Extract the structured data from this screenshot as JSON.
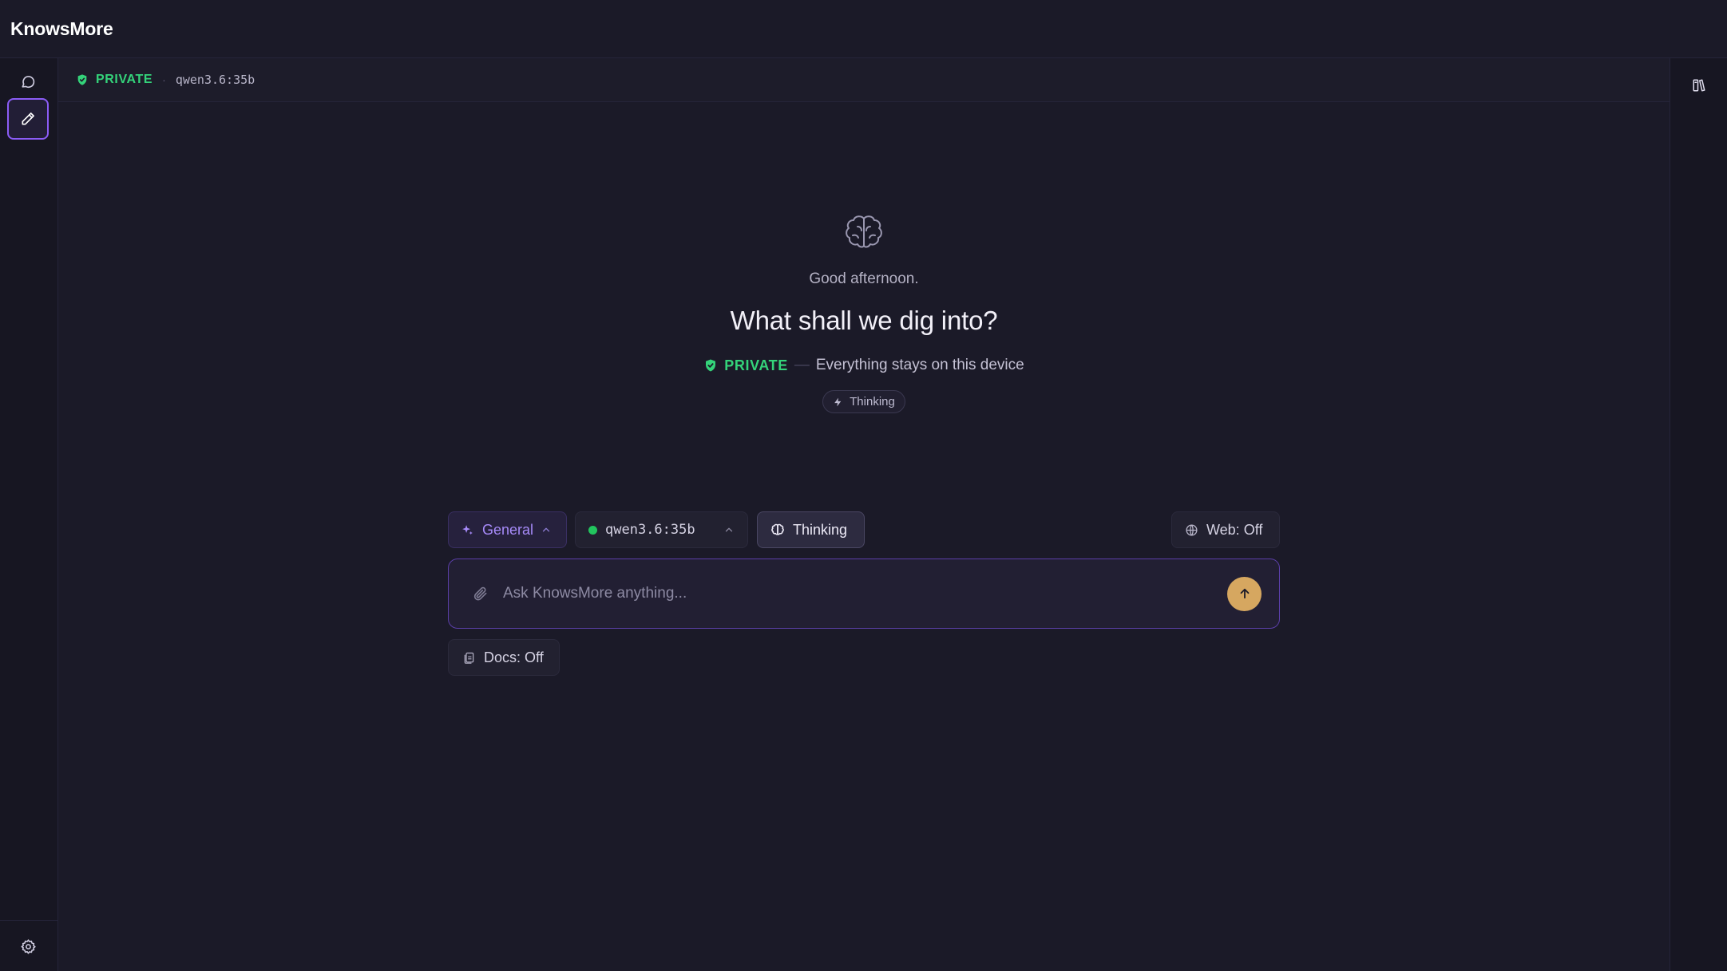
{
  "app": {
    "title": "KnowsMore"
  },
  "statusbar": {
    "privacy_label": "PRIVATE",
    "separator": "·",
    "model": "qwen3.6:35b"
  },
  "hero": {
    "greeting": "Good afternoon.",
    "headline": "What shall we dig into?",
    "privacy_label": "PRIVATE",
    "dash": "—",
    "privacy_desc": "Everything stays on this device",
    "mode_chip": "Thinking"
  },
  "controls": {
    "persona": "General",
    "model": "qwen3.6:35b",
    "thinking": "Thinking",
    "web": "Web: Off"
  },
  "input": {
    "placeholder": "Ask KnowsMore anything..."
  },
  "docs": {
    "label": "Docs: Off"
  },
  "colors": {
    "accent": "#8b5cf6",
    "private_green": "#34d37a",
    "send_button": "#d6a760",
    "background": "#1b1a28"
  },
  "icons": {
    "leftbar": [
      "chat-bubble-icon",
      "pencil-icon",
      "gear-icon"
    ],
    "rightbar": [
      "book-open-icon"
    ]
  }
}
